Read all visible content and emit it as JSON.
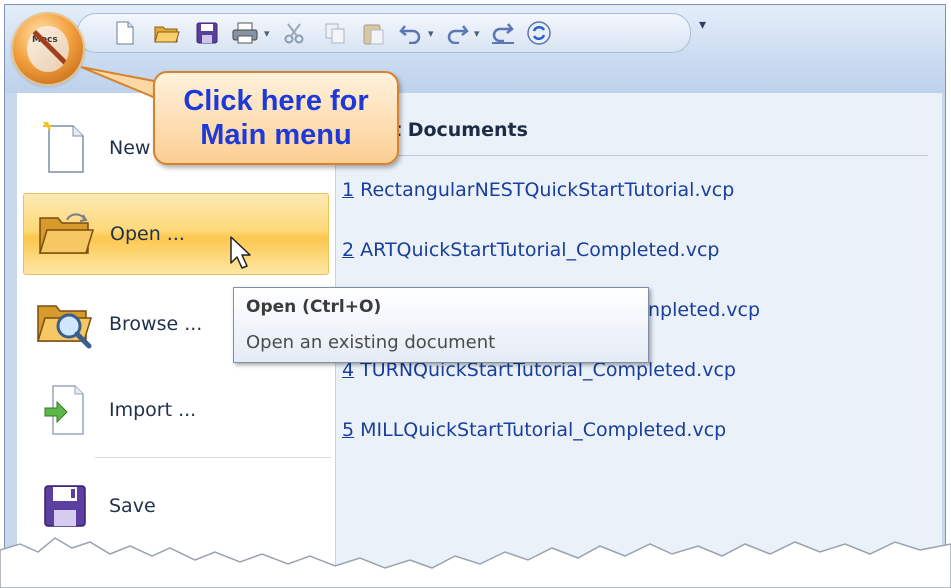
{
  "app": {
    "orb_logo_text": "Mecs",
    "quick_access_icons": [
      "new-file-icon",
      "open-folder-icon",
      "save-icon",
      "print-icon",
      "cut-icon",
      "copy-icon",
      "paste-icon",
      "undo-icon",
      "redo-icon",
      "redo-all-icon",
      "refresh-icon"
    ]
  },
  "callout": {
    "line1": "Click here for",
    "line2": "Main menu"
  },
  "menu": {
    "items": [
      {
        "label": "New",
        "icon": "new-document-icon"
      },
      {
        "label": "Open ...",
        "icon": "open-folder-icon"
      },
      {
        "label": "Browse ...",
        "icon": "browse-folder-icon"
      },
      {
        "label": "Import ...",
        "icon": "import-icon"
      },
      {
        "label": "Save",
        "icon": "save-icon"
      }
    ]
  },
  "recent": {
    "title": "t Documents",
    "items": [
      {
        "num": "1",
        "name": " RectangularNESTQuickStartTutorial.vcp"
      },
      {
        "num": "2",
        "name": " ARTQuickStartTutorial_Completed.vcp"
      },
      {
        "num": "",
        "name": "npleted.vcp"
      },
      {
        "num": "4",
        "name": " TURNQuickStartTutorial_Completed.vcp"
      },
      {
        "num": "5",
        "name": " MILLQuickStartTutorial_Completed.vcp"
      }
    ]
  },
  "tooltip": {
    "title": "Open (Ctrl+O)",
    "description": "Open an existing document"
  },
  "colors": {
    "callout_text": "#1d39d8",
    "hover_gold": "#fdc74e",
    "link_blue": "#1a3f9a"
  }
}
